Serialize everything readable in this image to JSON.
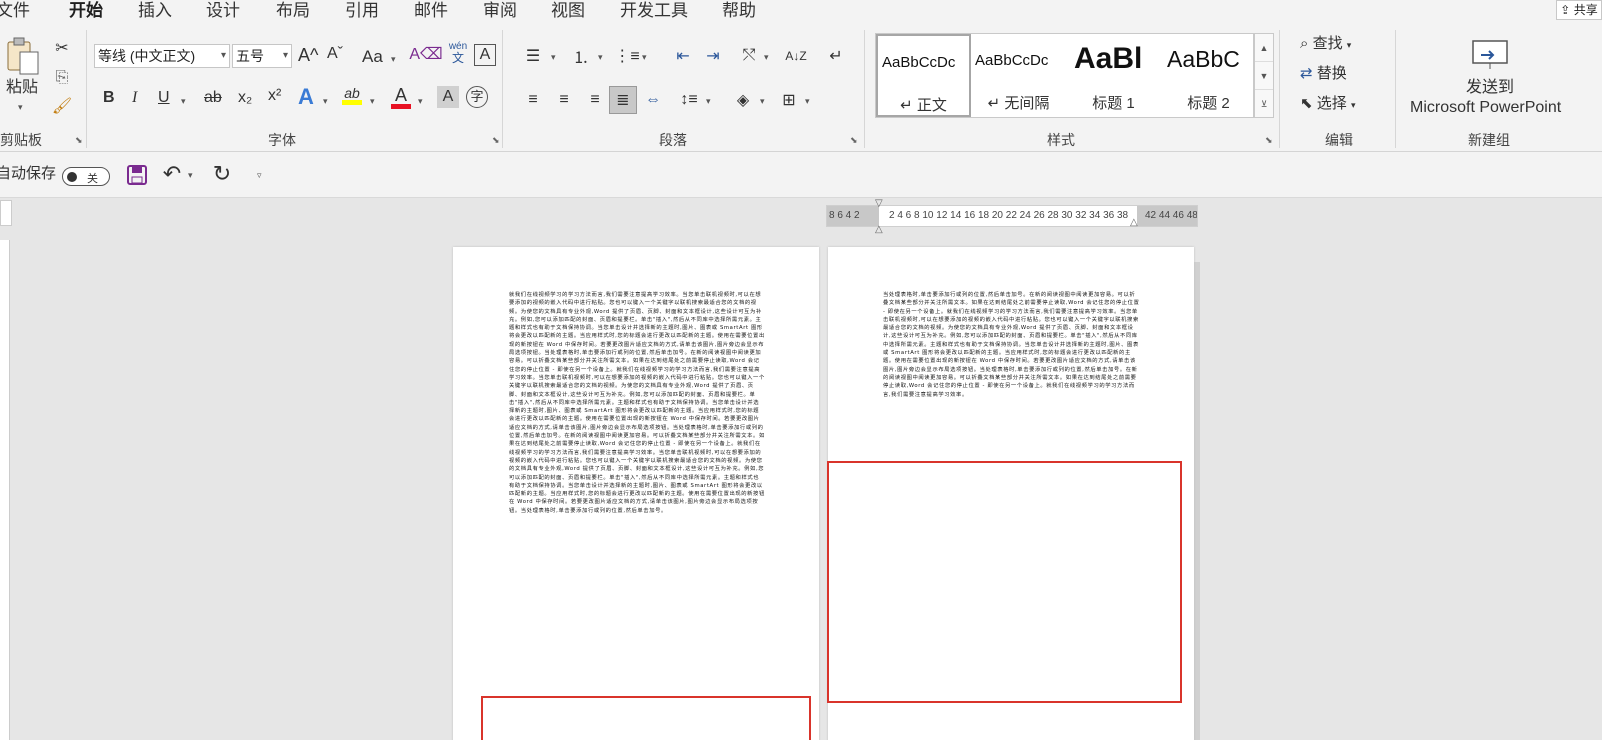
{
  "tabs": [
    {
      "label": "文件",
      "active": false
    },
    {
      "label": "开始",
      "active": true
    },
    {
      "label": "插入",
      "active": false
    },
    {
      "label": "设计",
      "active": false
    },
    {
      "label": "布局",
      "active": false
    },
    {
      "label": "引用",
      "active": false
    },
    {
      "label": "邮件",
      "active": false
    },
    {
      "label": "审阅",
      "active": false
    },
    {
      "label": "视图",
      "active": false
    },
    {
      "label": "开发工具",
      "active": false
    },
    {
      "label": "帮助",
      "active": false
    }
  ],
  "clipboard": {
    "paste_label": "粘贴",
    "group_label": "剪贴板"
  },
  "font": {
    "font_name": "等线 (中文正文)",
    "font_size": "五号",
    "grow_label": "A^",
    "shrink_label": "Aˇ",
    "case_label": "Aa",
    "phonetic_label": "wén",
    "phonetic_sub": "文",
    "border_char": "A",
    "bold": "B",
    "italic": "I",
    "underline": "U",
    "strike": "ab",
    "subscript": "x₂",
    "superscript": "x²",
    "effects": "A",
    "highlight": "ab",
    "color": "A",
    "shade": "A",
    "enclose": "字",
    "group_label": "字体"
  },
  "paragraph": {
    "group_label": "段落"
  },
  "styles": {
    "items": [
      {
        "sample": "AaBbCcDc",
        "name": "↵ 正文",
        "selected": true
      },
      {
        "sample": "AaBbCcDc",
        "name": "↵ 无间隔",
        "selected": false
      },
      {
        "sample": "AaBl",
        "name": "标题 1",
        "selected": false
      },
      {
        "sample": "AaBbC",
        "name": "标题 2",
        "selected": false
      }
    ],
    "group_label": "样式"
  },
  "editing": {
    "find": "查找",
    "replace": "替换",
    "select": "选择",
    "group_label": "编辑"
  },
  "new_group": {
    "send_label": "发送到",
    "send_target": "Microsoft PowerPoint",
    "group_label": "新建组"
  },
  "qat": {
    "autosave_label": "自动保存",
    "toggle_state": "关"
  },
  "share_label": "共享",
  "ruler": {
    "left_numbers": "8 6 4 2",
    "right_numbers": "2 4 6 8 10 12 14 16 18 20 22 24 26 28 30 32 34 36 38",
    "overflow_numbers": "42 44 46 48"
  },
  "document": {
    "page1_text": "就我们在线视频学习的学习方法而言,我们需要注意提高学习效率。当您单击联机视频时,可以在想要添加的视频的嵌入代码中进行粘贴。您也可以键入一个关键字以联机搜索最适合您的文档的视频。为使您的文档具有专业外观,Word 提供了页眉、页脚、封面和文本框设计,这些设计可互为补充。例如,您可以添加匹配的封面、页眉和提要栏。单击\"插入\",然后从不同库中选择所需元素。主题和样式也有助于文档保持协调。当您单击设计并选择新的主题时,图片、图表或 SmartArt 图形将会更改以匹配新的主题。当应用样式时,您的标题会进行更改以匹配新的主题。使用在需要位置出现的新按钮在 Word 中保存时间。若要更改图片适应文档的方式,请单击该图片,图片旁边会显示布局选项按钮。当处理表格时,单击要添加行或列的位置,然后单击加号。在新的阅读视图中阅读更加容易。可以折叠文档某些部分并关注所需文本。如果在达到结尾处之前需要停止读取,Word 会记住您的停止位置 - 即使在另一个设备上。就我们在线视频学习的学习方法而言,我们需要注意提高学习效率。当您单击联机视频时,可以在想要添加的视频的嵌入代码中进行粘贴。您也可以键入一个关键字以联机搜索最适合您的文档的视频。为使您的文档具有专业外观,Word 提供了页眉、页脚、封面和文本框设计,这些设计可互为补充。例如,您可以添加匹配的封面、页眉和提要栏。单击\"插入\",然后从不同库中选择所需元素。主题和样式也有助于文档保持协调。当您单击设计并选择新的主题时,图片、图表或 SmartArt 图形将会更改以匹配新的主题。当应用样式时,您的标题会进行更改以匹配新的主题。使用在需要位置出现的新按钮在 Word 中保存时间。若要更改图片适应文档的方式,请单击该图片,图片旁边会显示布局选项按钮。当处理表格时,单击要添加行或列的位置,然后单击加号。在新的阅读视图中阅读更加容易。可以折叠文档某些部分并关注所需文本。如果在达到结尾处之前需要停止读取,Word 会记住您的停止位置 - 即使在另一个设备上。就我们在线视频学习的学习方法而言,我们需要注意提高学习效率。当您单击联机视频时,可以在想要添加的视频的嵌入代码中进行粘贴。您也可以键入一个关键字以联机搜索最适合您的文档的视频。为使您的文档具有专业外观,Word 提供了页眉、页脚、封面和文本框设计,这些设计可互为补充。例如,您可以添加匹配的封面、页眉和提要栏。单击\"插入\",然后从不同库中选择所需元素。主题和样式也有助于文档保持协调。当您单击设计并选择新的主题时,图片、图表或 SmartArt 图形将会更改以匹配新的主题。当应用样式时,您的标题会进行更改以匹配新的主题。使用在需要位置出现的新按钮在 Word 中保存时间。若要更改图片适应文档的方式,请单击该图片,图片旁边会显示布局选项按钮。当处理表格时,单击要添加行或列的位置,然后单击加号。",
    "page2_text": "当处理表格时,单击要添加行或列的位置,然后单击加号。在新的阅读视图中阅读更加容易。可以折叠文档某些部分并关注所需文本。如果在达到结尾处之前需要停止读取,Word 会记住您的停止位置 - 即使在另一个设备上。就我们在线视频学习的学习方法而言,我们需要注意提高学习效率。当您单击联机视频时,可以在想要添加的视频的嵌入代码中进行粘贴。您也可以键入一个关键字以联机搜索最适合您的文档的视频。为使您的文档具有专业外观,Word 提供了页眉、页脚、封面和文本框设计,这些设计可互为补充。例如,您可以添加匹配的封面、页眉和提要栏。单击\"插入\",然后从不同库中选择所需元素。主题和样式也有助于文档保持协调。当您单击设计并选择新的主题时,图片、图表或 SmartArt 图形将会更改以匹配新的主题。当应用样式时,您的标题会进行更改以匹配新的主题。使用在需要位置出现的新按钮在 Word 中保存时间。若要更改图片适应文档的方式,请单击该图片,图片旁边会显示布局选项按钮。当处理表格时,单击要添加行或列的位置,然后单击加号。在新的阅读视图中阅读更加容易。可以折叠文档某些部分并关注所需文本。如果在达到结尾处之前需要停止读取,Word 会记住您的停止位置 - 即使在另一个设备上。就我们在线视频学习的学习方法而言,我们需要注意提高学习效率。"
  },
  "colors": {
    "accent": "#2b579a",
    "highlight_red": "#d9342b",
    "highlight_yellow": "#ffff00",
    "font_red": "#e81123",
    "paste_purple": "#7a2a8f"
  }
}
